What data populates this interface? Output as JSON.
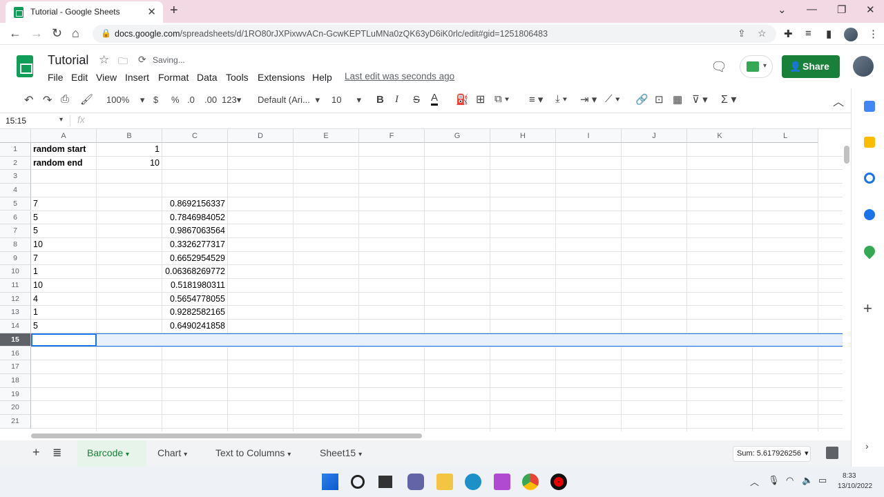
{
  "browser": {
    "tab_title": "Tutorial - Google Sheets",
    "url_domain": "docs.google.com",
    "url_path": "/spreadsheets/d/1RO80rJXPixwvACn-GcwKEPTLuMNa0zQK63yD6iK0rlc/edit#gid=1251806483"
  },
  "doc": {
    "title": "Tutorial",
    "status": "Saving...",
    "last_edit": "Last edit was seconds ago",
    "share_label": "Share"
  },
  "menu": [
    "File",
    "Edit",
    "View",
    "Insert",
    "Format",
    "Data",
    "Tools",
    "Extensions",
    "Help"
  ],
  "toolbar": {
    "zoom": "100%",
    "currency": "$",
    "percent": "%",
    "dec_less": ".0",
    "dec_more": ".00",
    "more_formats": "123",
    "font": "Default (Ari...",
    "font_size": "10",
    "bold": "B",
    "italic": "I",
    "strike": "S",
    "text_color": "A"
  },
  "formula_bar": {
    "name_box": "15:15",
    "fx": "fx"
  },
  "columns": [
    "A",
    "B",
    "C",
    "D",
    "E",
    "F",
    "G",
    "H",
    "I",
    "J",
    "K",
    "L"
  ],
  "rows": [
    "1",
    "2",
    "3",
    "4",
    "5",
    "6",
    "7",
    "8",
    "9",
    "10",
    "11",
    "12",
    "13",
    "14",
    "15",
    "16",
    "17",
    "18",
    "19",
    "20",
    "21"
  ],
  "cells": {
    "A1": "random start",
    "B1": "1",
    "A2": "random end",
    "B2": "10",
    "A5": "7",
    "C5": "0.8692156337",
    "A6": "5",
    "C6": "0.7846984052",
    "A7": "5",
    "C7": "0.9867063564",
    "A8": "10",
    "C8": "0.3326277317",
    "A9": "7",
    "C9": "0.6652954529",
    "A10": "1",
    "C10": "0.06368269772",
    "A11": "10",
    "C11": "0.5181980311",
    "A12": "4",
    "C12": "0.5654778055",
    "A13": "1",
    "C13": "0.9282582165",
    "A14": "5",
    "C14": "0.6490241858"
  },
  "sheets": [
    "Barcode",
    "Chart",
    "Text to Columns",
    "Sheet15"
  ],
  "active_sheet": "Barcode",
  "sum": "Sum: 5.617926256",
  "taskbar": {
    "time": "8:33",
    "date": "13/10/2022"
  },
  "colors": {
    "accent_green": "#188038",
    "selection_blue": "#1a73e8",
    "title_bar": "#f2d9e4"
  }
}
